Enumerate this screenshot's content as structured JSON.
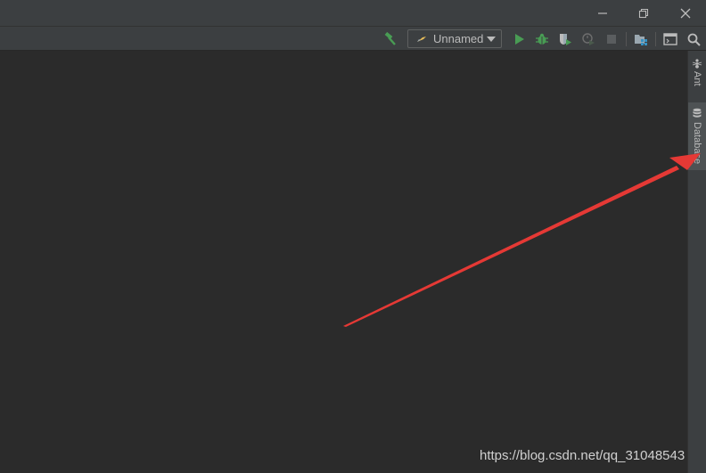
{
  "window": {
    "controls": {
      "minimize_icon": "minimize-icon",
      "restore_icon": "restore-icon",
      "close_icon": "close-icon"
    }
  },
  "toolbar": {
    "run_config_label": "Unnamed",
    "icons": [
      "hammer-icon",
      "run-icon",
      "debug-icon",
      "coverage-icon",
      "profile-icon",
      "stop-icon",
      "project-structure-icon",
      "terminal-icon",
      "search-icon"
    ],
    "colors": {
      "green": "#499c54",
      "accent": "#3592c4"
    }
  },
  "tool_windows": {
    "right": [
      {
        "label": "Ant",
        "icon": "ant-icon"
      },
      {
        "label": "Database",
        "icon": "database-icon"
      }
    ]
  },
  "annotation": {
    "arrow_color": "#e53935"
  },
  "watermark": "https://blog.csdn.net/qq_31048543"
}
